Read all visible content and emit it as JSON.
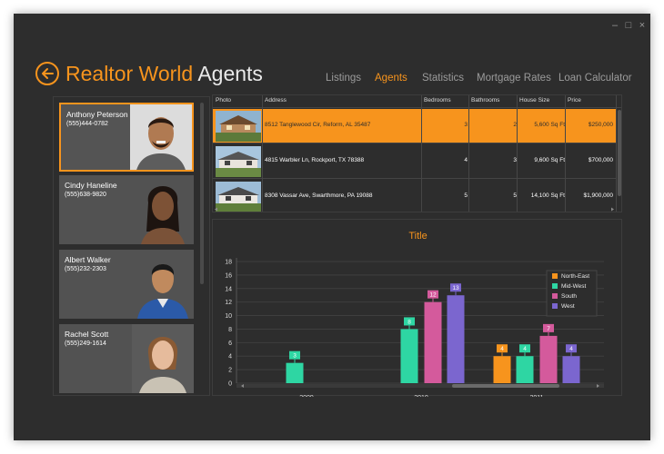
{
  "window": {
    "minimize": "–",
    "maximize": "□",
    "close": "×"
  },
  "header": {
    "title_part1": "Realtor World ",
    "title_part2": "Agents",
    "back_icon": "arrow-left-circle-icon"
  },
  "nav": {
    "items": [
      {
        "label": "Listings",
        "active": false
      },
      {
        "label": "Agents",
        "active": true
      },
      {
        "label": "Statistics",
        "active": false
      },
      {
        "label": "Mortgage Rates",
        "active": false
      },
      {
        "label": "Loan Calculator",
        "active": false
      }
    ]
  },
  "agents": [
    {
      "name": "Anthony Peterson",
      "phone": "(555)444-0782",
      "selected": true
    },
    {
      "name": "Cindy Haneline",
      "phone": "(555)638-9820",
      "selected": false
    },
    {
      "name": "Albert Walker",
      "phone": "(555)232-2303",
      "selected": false
    },
    {
      "name": "Rachel Scott",
      "phone": "(555)249-1614",
      "selected": false
    }
  ],
  "listings": {
    "columns": [
      "Photo",
      "Address",
      "Bedrooms",
      "Bathrooms",
      "House Size",
      "Price"
    ],
    "rows": [
      {
        "address": "8512 Tanglewood Cir,  Reform, AL 35487",
        "bedrooms": "3",
        "bathrooms": "2",
        "size": "5,600 Sq Ft",
        "price": "$250,000",
        "selected": true
      },
      {
        "address": "4815 Warbler Ln,  Rockport, TX 78388",
        "bedrooms": "4",
        "bathrooms": "3",
        "size": "9,600 Sq Ft",
        "price": "$700,000",
        "selected": false
      },
      {
        "address": "8308 Vassar Ave,  Swarthmore, PA 19088",
        "bedrooms": "5",
        "bathrooms": "5",
        "size": "14,100 Sq Ft",
        "price": "$1,900,000",
        "selected": false
      }
    ]
  },
  "colors": {
    "accent": "#f7941d",
    "north_east": "#f7941d",
    "mid_west": "#2ed6a3",
    "south": "#d45a9c",
    "west": "#7b66cf"
  },
  "chart_data": {
    "type": "bar",
    "title": "Title",
    "categories": [
      "2009",
      "2010",
      "2011"
    ],
    "series": [
      {
        "name": "North-East",
        "values": [
          null,
          null,
          4
        ]
      },
      {
        "name": "Mid-West",
        "values": [
          3,
          8,
          4
        ]
      },
      {
        "name": "South",
        "values": [
          null,
          12,
          7
        ]
      },
      {
        "name": "West",
        "values": [
          null,
          13,
          4
        ]
      }
    ],
    "ylim": [
      0,
      18
    ],
    "yticks": [
      0,
      2,
      4,
      6,
      8,
      10,
      12,
      14,
      16,
      18
    ],
    "grid": true,
    "legend": "top-right",
    "data_labels": true
  }
}
